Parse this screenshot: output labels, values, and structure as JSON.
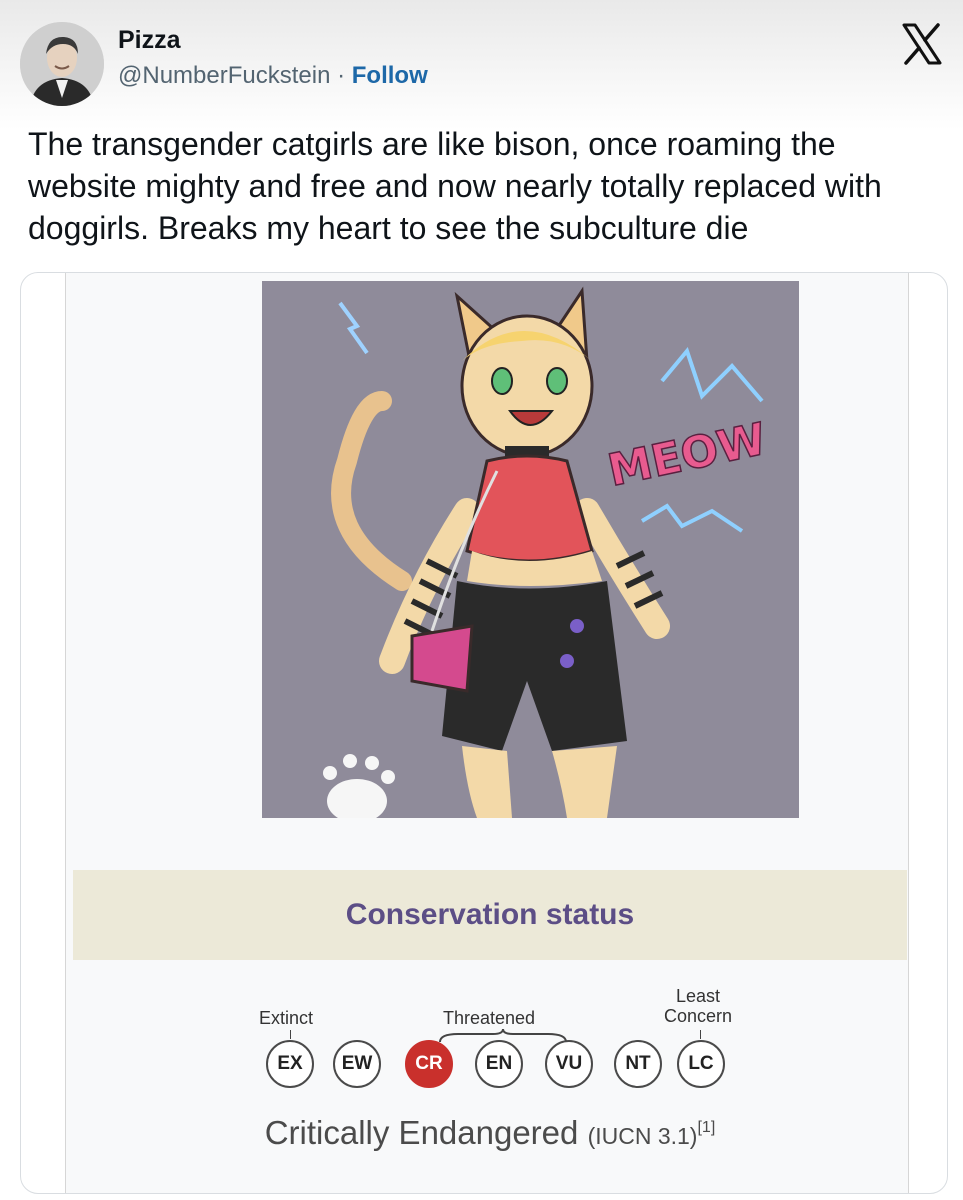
{
  "post": {
    "display_name": "Pizza",
    "handle": "@NumberFuckstein",
    "separator": " · ",
    "follow_label": "Follow",
    "text": "The transgender catgirls are like bison, once roaming the website mighty and free and now nearly totally replaced with doggirls. Breaks my heart to see the subculture die"
  },
  "icons": {
    "avatar": "man-portrait-avatar",
    "platform": "x-logo-icon"
  },
  "media": {
    "image_text": "MEOW",
    "conservation_status_title": "Conservation status",
    "scale": {
      "extinct_label": "Extinct",
      "threatened_label": "Threatened",
      "least_label": "Least",
      "concern_label": "Concern",
      "categories": [
        "EX",
        "EW",
        "CR",
        "EN",
        "VU",
        "NT",
        "LC"
      ],
      "selected": "CR",
      "selected_color": "#c9302c"
    },
    "status_main": "Critically Endangered",
    "status_system": "(IUCN 3.1)",
    "status_ref": "[1]"
  },
  "colors": {
    "follow": "#1d68a8",
    "status_header_bg": "#ece9d8",
    "status_header_text": "#5c4e86",
    "image_background": "#8f8b9a"
  }
}
